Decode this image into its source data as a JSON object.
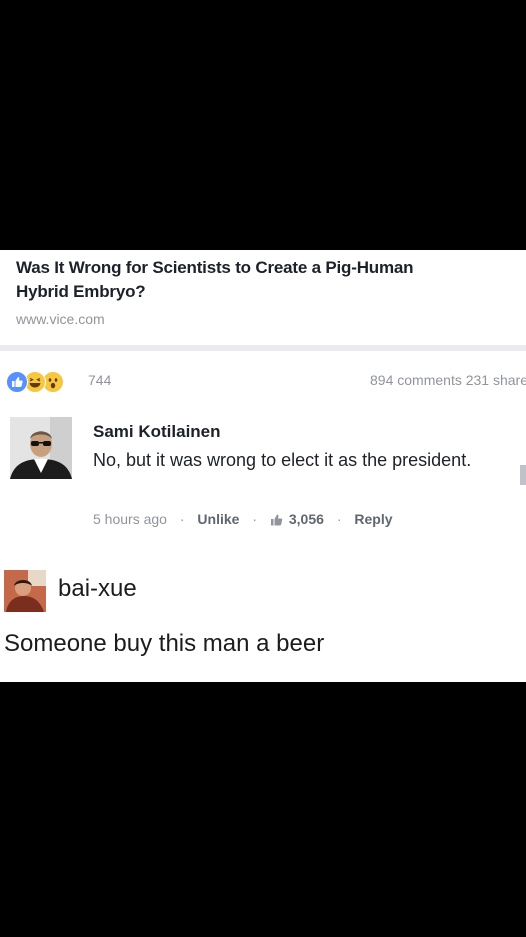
{
  "post": {
    "title": "Was It Wrong for Scientists to Create a Pig-Human\nHybrid Embryo?",
    "domain": "www.vice.com"
  },
  "stats": {
    "reaction_icons": [
      "like-icon",
      "haha-icon",
      "wow-icon"
    ],
    "reaction_count": "744",
    "comments_shares": "894 comments 231 share"
  },
  "comments": [
    {
      "author": "Sami Kotilainen",
      "text": "No, but it was wrong to elect it as the president.",
      "time": "5 hours ago",
      "unlike": "Unlike",
      "likes": "3,056",
      "reply": "Reply",
      "separator": "·"
    },
    {
      "author": "bai-xue",
      "text": "Someone buy this man a beer"
    }
  ],
  "colors": {
    "background": "#000000",
    "card": "#ffffff",
    "text": "#1d2129",
    "meta": "#90949c",
    "like_blue": "#5890ff",
    "emoji_yellow": "#f7c740"
  }
}
